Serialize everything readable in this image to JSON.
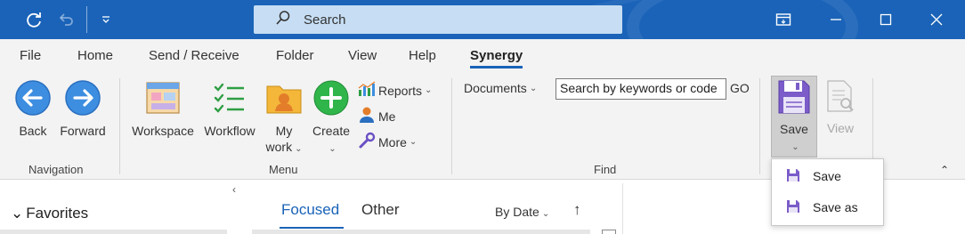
{
  "titlebar": {
    "search_placeholder": "Search",
    "accent": "#1a63b8"
  },
  "menu_tabs": [
    "File",
    "Home",
    "Send / Receive",
    "Folder",
    "View",
    "Help",
    "Synergy"
  ],
  "active_tab": "Synergy",
  "ribbon": {
    "navigation": {
      "label": "Navigation",
      "back": "Back",
      "forward": "Forward"
    },
    "menu": {
      "label": "Menu",
      "workspace": "Workspace",
      "workflow": "Workflow",
      "my_work_1": "My",
      "my_work_2": "work",
      "create": "Create",
      "reports": "Reports",
      "me": "Me",
      "more": "More"
    },
    "find": {
      "label": "Find",
      "documents": "Documents",
      "search_value": "Search by keywords or code",
      "go": "GO"
    },
    "save_group": {
      "save": "Save",
      "view": "View"
    }
  },
  "save_dropdown": {
    "items": [
      "Save",
      "Save as"
    ]
  },
  "folder_pane": {
    "favorites": "Favorites"
  },
  "message_list": {
    "focused": "Focused",
    "other": "Other",
    "sort": "By Date",
    "sort_arrow": "↑"
  },
  "icons": [
    "refresh-icon",
    "undo-icon",
    "customize-qat-icon",
    "search-icon",
    "ribbon-display-icon",
    "minimize-icon",
    "maximize-icon",
    "close-icon",
    "back-icon",
    "forward-icon",
    "workspace-icon",
    "workflow-icon",
    "my-work-icon",
    "create-icon",
    "reports-icon",
    "me-icon",
    "more-icon",
    "save-icon",
    "view-icon"
  ]
}
